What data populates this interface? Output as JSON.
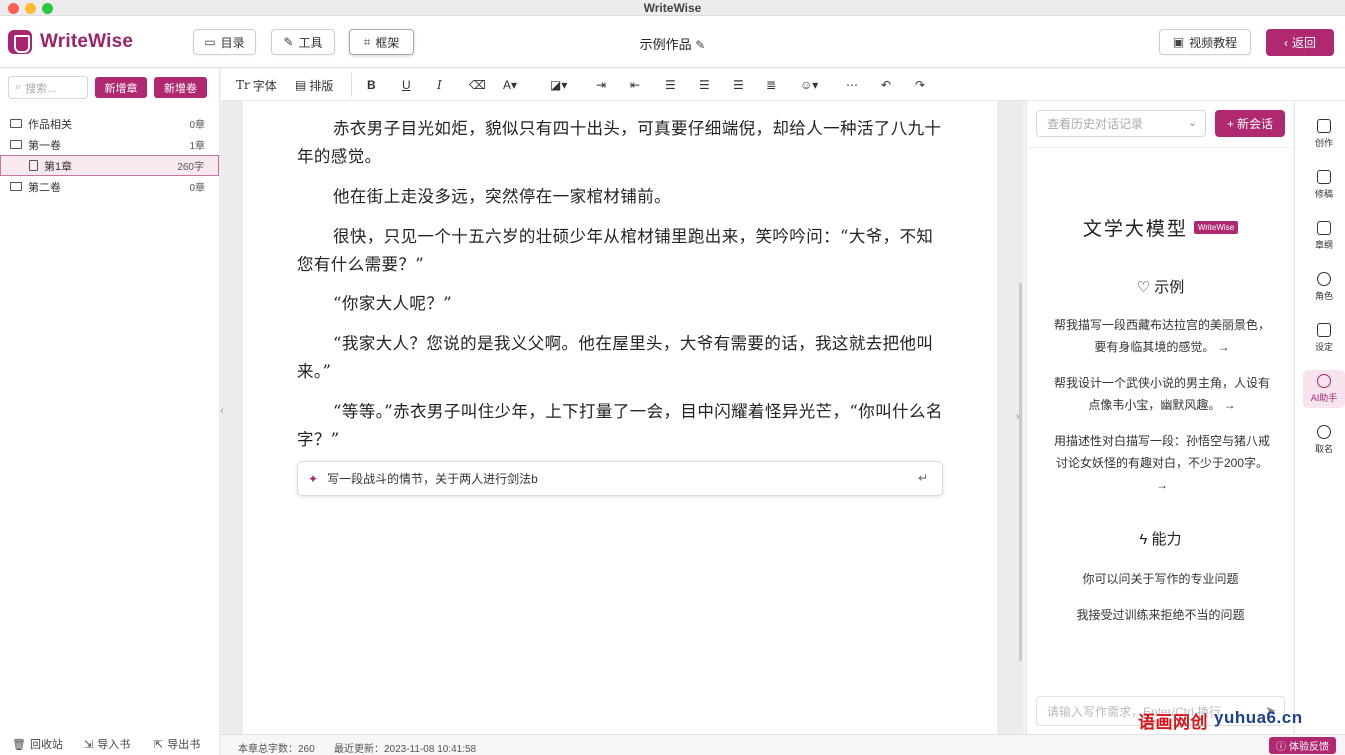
{
  "window": {
    "title": "WriteWise"
  },
  "header": {
    "logo_text": "WriteWise",
    "btn_catalog": "目录",
    "btn_tools": "工具",
    "btn_frame": "框架",
    "doc_title": "示例作品",
    "btn_video": "视频教程",
    "btn_back": "返回"
  },
  "sidebar": {
    "search_placeholder": "搜索...",
    "btn_new_chapter": "新增章",
    "btn_new_volume": "新增卷",
    "tree": [
      {
        "label": "作品相关",
        "count": "0章"
      },
      {
        "label": "第一卷",
        "count": "1章"
      },
      {
        "label": "第1章",
        "count": "260字"
      },
      {
        "label": "第二卷",
        "count": "0章"
      }
    ],
    "footer": {
      "recycle": "回收站",
      "import": "导入书",
      "export": "导出书"
    }
  },
  "toolbar": {
    "font": "字体",
    "font_prefix": "Tr",
    "layout": "排版"
  },
  "editor": {
    "paragraphs": [
      "赤衣男子目光如炬，貌似只有四十出头，可真要仔细端倪，却给人一种活了八九十年的感觉。",
      "他在街上走没多远，突然停在一家棺材铺前。",
      "很快，只见一个十五六岁的壮硕少年从棺材铺里跑出来，笑吟吟问：“大爷，不知您有什么需要？”",
      "“你家大人呢？”",
      "“我家大人？您说的是我义父啊。他在屋里头，大爷有需要的话，我这就去把他叫来。”",
      "“等等。”赤衣男子叫住少年，上下打量了一会，目中闪耀着怪异光芒，“你叫什么名字？”"
    ],
    "prompt_value": "写一段战斗的情节，关于两人进行剑法b"
  },
  "status": {
    "word_count_label": "本章总字数：",
    "word_count": "260",
    "updated_label": "最近更新：",
    "updated": "2023-11-08 10:41:58",
    "feedback": "体验反馈"
  },
  "ai": {
    "history_placeholder": "查看历史对话记录",
    "new_chat": "新会话",
    "title": "文学大模型",
    "badge": "WriteWise",
    "examples_title": "示例",
    "examples": [
      "帮我描写一段西藏布达拉宫的美丽景色，要有身临其境的感觉。",
      "帮我设计一个武侠小说的男主角，人设有点像韦小宝，幽默风趣。",
      "用描述性对白描写一段：孙悟空与猪八戒讨论女妖怪的有趣对白，不少于200字。"
    ],
    "abilities_title": "能力",
    "abilities": [
      "你可以问关于写作的专业问题",
      "我接受过训练来拒绝不当的问题"
    ],
    "input_placeholder": "请输入写作需求，Enter/Ctrl 换行"
  },
  "rail": {
    "items": [
      "创作",
      "修稿",
      "章纲",
      "角色",
      "设定",
      "AI助手",
      "取名"
    ]
  },
  "watermark": {
    "left": "语画网创",
    "right": "yuhua6.cn"
  },
  "colors": {
    "accent": "#b0286f"
  }
}
